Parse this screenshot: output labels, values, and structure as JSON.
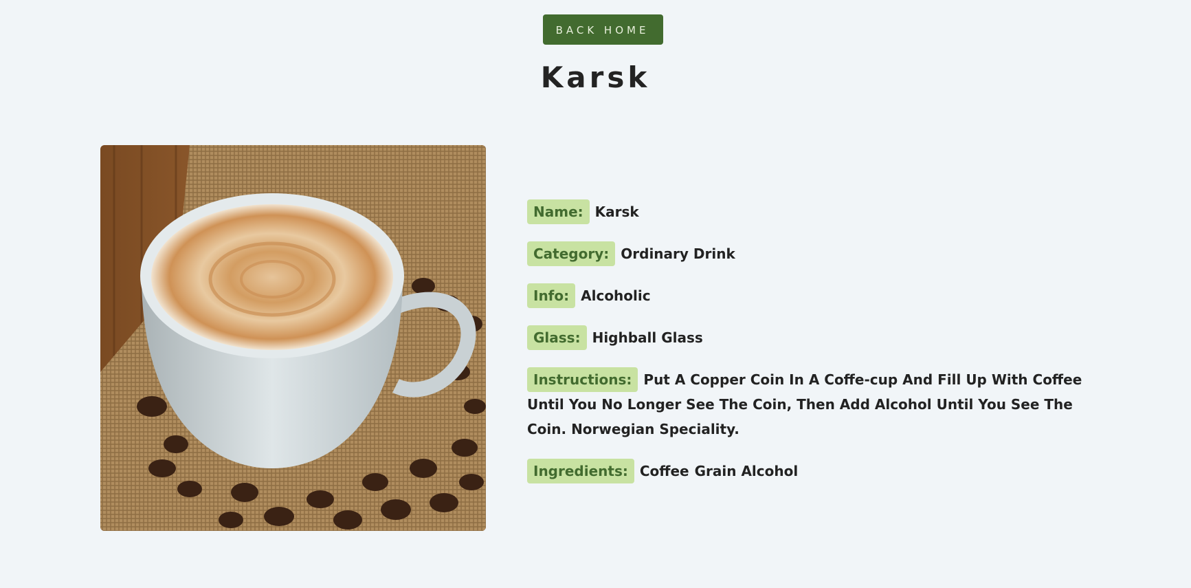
{
  "nav": {
    "back_label": "Back Home"
  },
  "drink": {
    "title": "Karsk",
    "image_subject": "coffee-cup-image",
    "details": {
      "name": {
        "label": "Name:",
        "value": "Karsk"
      },
      "category": {
        "label": "Category:",
        "value": "Ordinary Drink"
      },
      "info": {
        "label": "Info:",
        "value": "Alcoholic"
      },
      "glass": {
        "label": "Glass:",
        "value": "Highball Glass"
      },
      "instructions": {
        "label": "Instructions:",
        "value": "Put A Copper Coin In A Coffe-cup And Fill Up With Coffee Until You No Longer See The Coin, Then Add Alcohol Until You See The Coin. Norwegian Speciality."
      },
      "ingredients": {
        "label": "Ingredients:",
        "items": [
          "Coffee",
          "Grain Alcohol"
        ]
      }
    }
  },
  "colors": {
    "background": "#f1f5f8",
    "button": "#426b2f",
    "label_bg": "#c8e2a2",
    "label_text": "#426b2f"
  }
}
